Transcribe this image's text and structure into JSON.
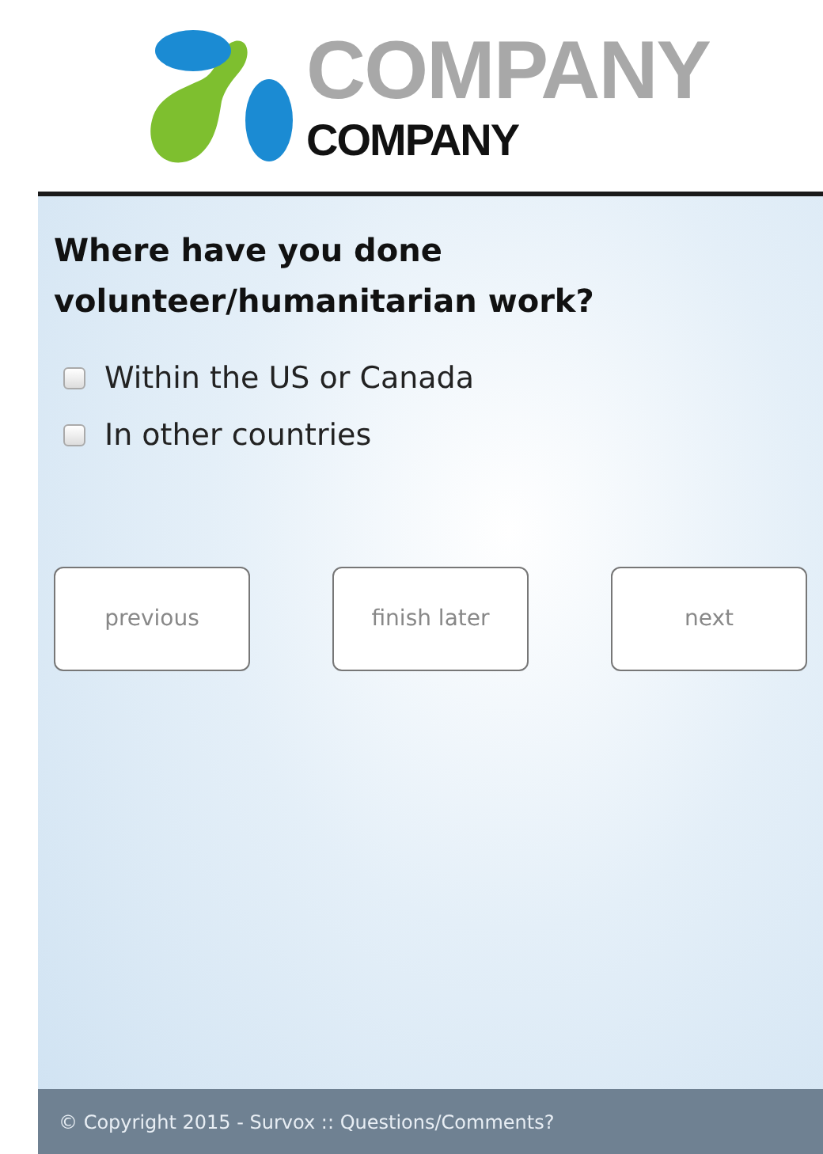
{
  "logo": {
    "title": "COMPANY",
    "subtitle": "COMPANY"
  },
  "question": "Where have you done volunteer/humanitarian work?",
  "options": [
    {
      "label": "Within the US or Canada",
      "checked": false
    },
    {
      "label": "In other countries",
      "checked": false
    }
  ],
  "buttons": [
    "previous",
    "finish later",
    "next"
  ],
  "footer": {
    "copyright": "© Copyright 2015 - Survox :: ",
    "link": "Questions/Comments?"
  }
}
